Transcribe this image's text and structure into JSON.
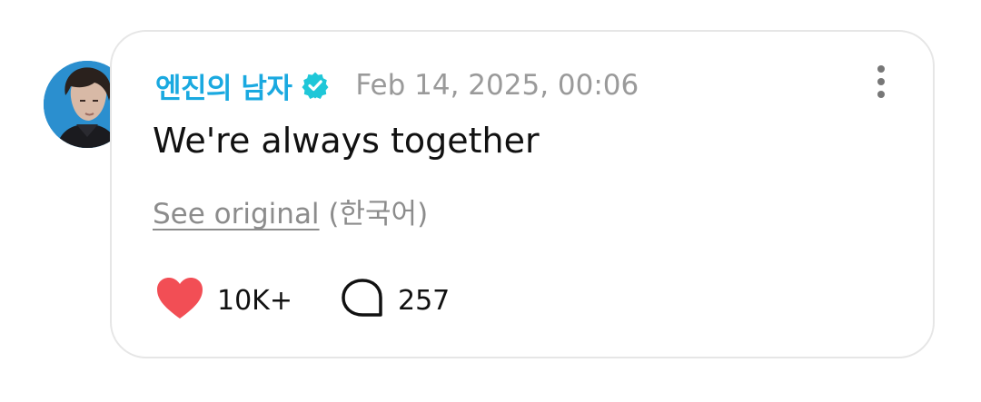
{
  "post": {
    "author": "엔진의 남자",
    "verified": true,
    "timestamp": "Feb 14, 2025, 00:06",
    "text": "We're always together",
    "see_original_label": "See original",
    "original_language": "(한국어)",
    "likes": "10K+",
    "comments": "257"
  },
  "icons": {
    "verified": "verified-badge-icon",
    "more": "more-vertical-icon",
    "like": "heart-icon",
    "comment": "comment-bubble-icon"
  },
  "colors": {
    "author": "#1aa9e0",
    "verified_badge": "#1fc7d8",
    "heart": "#f24e55",
    "muted_text": "#9a9a9a",
    "card_border": "#e6e6e6"
  }
}
